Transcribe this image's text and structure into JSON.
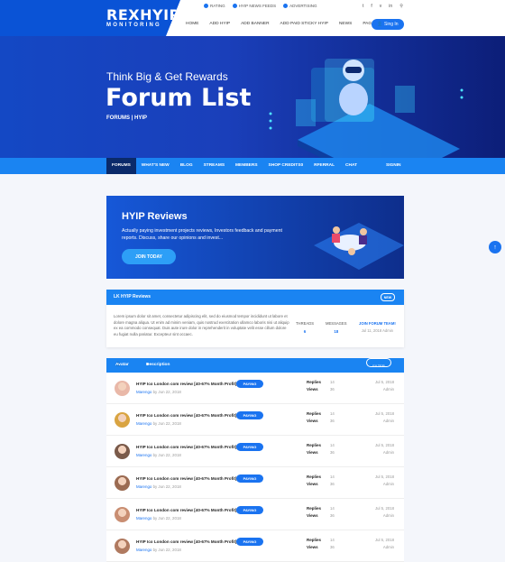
{
  "brand": {
    "name": "REXHYIP",
    "tagline": "MONITORING"
  },
  "toplinks": [
    {
      "label": "RATING"
    },
    {
      "label": "HYIP NEWS FEEDS"
    },
    {
      "label": "ADVERTISING"
    }
  ],
  "social": [
    "twitter-icon",
    "facebook-icon",
    "vk-icon",
    "linkedin-icon",
    "search-icon"
  ],
  "mainnav": [
    {
      "label": "HOME"
    },
    {
      "label": "ADD HYIP"
    },
    {
      "label": "ADD BANNER"
    },
    {
      "label": "ADD PAID STICKY HYIP"
    },
    {
      "label": "NEWS"
    },
    {
      "label": "PAGES ▾"
    }
  ],
  "signin": "Sing In",
  "hero": {
    "subtitle": "Think Big & Get Rewards",
    "title": "Forum List",
    "breadcrumb": "FORUMS | HYIP"
  },
  "subnav": {
    "items": [
      {
        "label": "FORUMS"
      },
      {
        "label": "WHAT'S NEW"
      },
      {
        "label": "BLOG"
      },
      {
        "label": "STREAMS"
      },
      {
        "label": "MEMBERS"
      },
      {
        "label": "SHOP CREDITS0"
      },
      {
        "label": "RFERRAL"
      },
      {
        "label": "CHAT"
      }
    ],
    "signin": "SIGNIN"
  },
  "promo": {
    "heading": "HYIP Reviews",
    "text": "Actually paying investment projects reviews, Investors feedback and payment reports. Discuss, share our opinions and invest...",
    "button": "JOIN TODAY"
  },
  "card": {
    "title": "LK HYIP Reviews",
    "badge": "NEW",
    "description": "Lorem ipsum dolor sit amet, consectetur adipiscing elit, sed do eiusmod tempor incididunt ut labore et dolore magna aliqua. Ut enim ad minim veniam, quis nostrud exercitation ullamco laboris nisi ut aliquip ex ea commodo consequat. Duis aute irure dolor in reprehenderit in voluptate velit esse cillum dolore eu fugiat nulla pariatur. Excepteur sint occaec.",
    "threads_label": "THREADS",
    "threads": "6",
    "messages_label": "MESSAGES",
    "messages": "18",
    "latest_label": "JOIN FORUM TEAM!",
    "latest_meta": "Jul 11, 2018 Admin"
  },
  "table": {
    "col_avatar": "Avatar",
    "col_description": "Description",
    "filter": "FILTER"
  },
  "rows": [
    {
      "title": "HYIP Ico London com review [40-67% Month Profit]",
      "author": "Marengo",
      "date": "by Jun 22, 2018",
      "status": "PAYING",
      "replies_label": "Replies",
      "views_label": "Views",
      "replies": "14",
      "views": "36",
      "last_date": "Jul 5, 2018",
      "last_user": "Admin",
      "avatar_color": "#e9b8a8"
    },
    {
      "title": "HYIP Ico London com review [40-67% Month Profit]",
      "author": "Marengo",
      "date": "by Jun 22, 2018",
      "status": "PAYING",
      "replies_label": "Replies",
      "views_label": "Views",
      "replies": "14",
      "views": "36",
      "last_date": "Jul 5, 2018",
      "last_user": "Admin",
      "avatar_color": "#d9a441"
    },
    {
      "title": "HYIP Ico London com review [40-67% Month Profit]",
      "author": "Marengo",
      "date": "by Jun 22, 2018",
      "status": "PAYING",
      "replies_label": "Replies",
      "views_label": "Views",
      "replies": "14",
      "views": "36",
      "last_date": "Jul 5, 2018",
      "last_user": "Admin",
      "avatar_color": "#7a5a4a"
    },
    {
      "title": "HYIP Ico London com review [40-67% Month Profit]",
      "author": "Marengo",
      "date": "by Jun 22, 2018",
      "status": "PAYING",
      "replies_label": "Replies",
      "views_label": "Views",
      "replies": "14",
      "views": "36",
      "last_date": "Jul 5, 2018",
      "last_user": "Admin",
      "avatar_color": "#9b6b52"
    },
    {
      "title": "HYIP Ico London com review [40-67% Month Profit]",
      "author": "Marengo",
      "date": "by Jun 22, 2018",
      "status": "PAYING",
      "replies_label": "Replies",
      "views_label": "Views",
      "replies": "14",
      "views": "36",
      "last_date": "Jul 5, 2018",
      "last_user": "Admin",
      "avatar_color": "#c98e72"
    },
    {
      "title": "HYIP Ico London com review [40-67% Month Profit]",
      "author": "Marengo",
      "date": "by Jun 22, 2018",
      "status": "PAYING",
      "replies_label": "Replies",
      "views_label": "Views",
      "replies": "14",
      "views": "36",
      "last_date": "Jul 5, 2018",
      "last_user": "Admin",
      "avatar_color": "#b07a60"
    }
  ],
  "colors": {
    "primary": "#1a73f0",
    "nav": "#1a84f2",
    "hero": "#1448c4"
  }
}
